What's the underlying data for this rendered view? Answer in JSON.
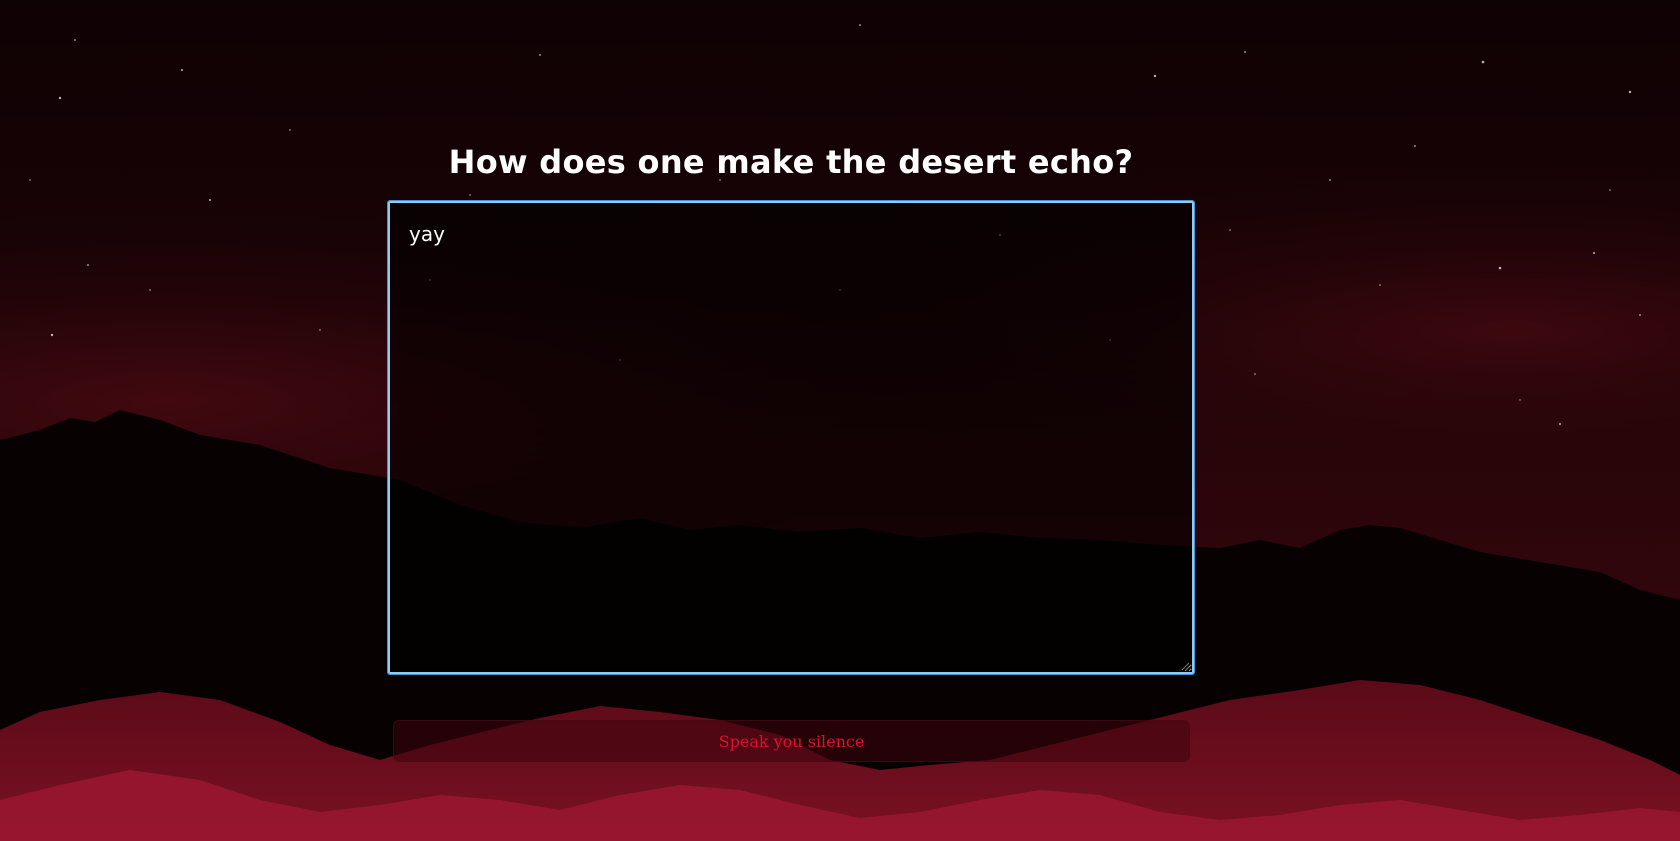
{
  "prompt": {
    "title": "How does one make the desert echo?"
  },
  "answer_field": {
    "value": "yay"
  },
  "submit_button": {
    "label": "Speak you silence"
  },
  "colors": {
    "background": "#0c0204",
    "title_text": "#ffffff",
    "field_border": "#8ecdf0",
    "button_text": "#e0102a"
  }
}
